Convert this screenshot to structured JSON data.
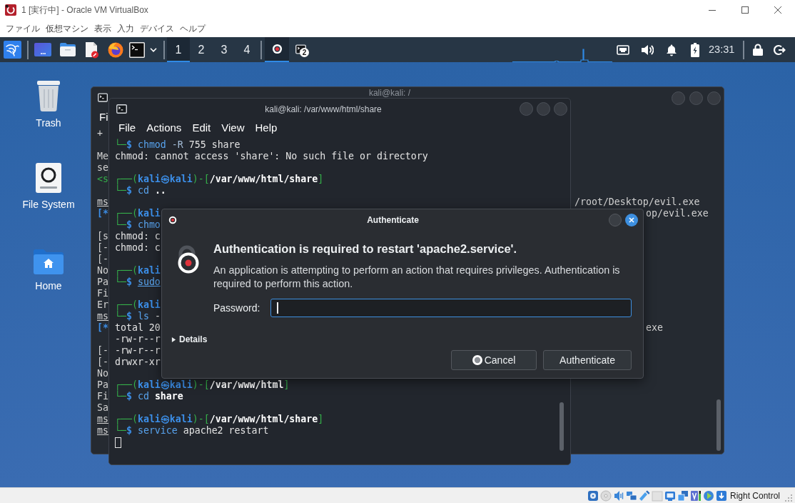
{
  "window": {
    "title": "1 [実行中] - Oracle VM VirtualBox"
  },
  "menu": [
    "ファイル",
    "仮想マシン",
    "表示",
    "入力",
    "デバイス",
    "ヘルプ"
  ],
  "panel": {
    "workspaces": [
      {
        "label": "1",
        "selected": true
      },
      {
        "label": "2",
        "selected": false
      },
      {
        "label": "3",
        "selected": false
      },
      {
        "label": "4",
        "selected": false
      }
    ],
    "tasks": [
      {
        "kind": "record",
        "selected": true
      },
      {
        "kind": "terminal",
        "selected": false,
        "badge": "2"
      }
    ],
    "clock": "23:31"
  },
  "desktop_icons": [
    {
      "kind": "trash",
      "label": "Trash"
    },
    {
      "kind": "drive",
      "label": "File System"
    },
    {
      "kind": "home",
      "label": "Home"
    }
  ],
  "back_terminal": {
    "title": "kali@kali: /",
    "menu": [
      "Fi"
    ],
    "lines": [
      {
        "kind": "text",
        "left": {
          "kind": "text",
          "text": "+"
        }
      },
      {
        "kind": "blank"
      },
      {
        "kind": "text",
        "left": {
          "kind": "text",
          "text": "Me"
        }
      },
      {
        "kind": "text",
        "left": {
          "kind": "text",
          "text": "se"
        }
      },
      {
        "kind": "text",
        "left": {
          "kind": "hint",
          "text": "<s"
        }
      },
      {
        "kind": "blank"
      },
      {
        "kind": "text",
        "left": {
          "kind": "prompt",
          "text": "ms"
        },
        "right": "/root/Desktop/evil.exe"
      },
      {
        "kind": "text",
        "left": {
          "kind": "info",
          "text": "[*"
        },
        "right": "op/evil.exe"
      },
      {
        "kind": "blank"
      },
      {
        "kind": "text",
        "left": {
          "kind": "text",
          "text": "[s"
        }
      },
      {
        "kind": "text",
        "left": {
          "kind": "text",
          "text": "[-"
        }
      },
      {
        "kind": "text",
        "left": {
          "kind": "text",
          "text": "[-"
        }
      },
      {
        "kind": "text",
        "left": {
          "kind": "text",
          "text": "No"
        }
      },
      {
        "kind": "text",
        "left": {
          "kind": "text",
          "text": "Pa"
        }
      },
      {
        "kind": "text",
        "left": {
          "kind": "text",
          "text": "Fi"
        }
      },
      {
        "kind": "text",
        "left": {
          "kind": "text",
          "text": "Er"
        }
      },
      {
        "kind": "text",
        "left": {
          "kind": "prompt",
          "text": "ms"
        }
      },
      {
        "kind": "text",
        "left": {
          "kind": "info",
          "text": "[*"
        },
        "right": "exe"
      },
      {
        "kind": "blank"
      },
      {
        "kind": "text",
        "left": {
          "kind": "text",
          "text": "[-"
        }
      },
      {
        "kind": "text",
        "left": {
          "kind": "text",
          "text": "[-"
        }
      },
      {
        "kind": "text",
        "left": {
          "kind": "text",
          "text": "No"
        }
      },
      {
        "kind": "text",
        "left": {
          "kind": "text",
          "text": "Pa"
        }
      },
      {
        "kind": "text",
        "left": {
          "kind": "text",
          "text": "Fi"
        }
      },
      {
        "kind": "text",
        "left": {
          "kind": "text",
          "text": "Sa"
        }
      },
      {
        "kind": "text",
        "left": {
          "kind": "prompt",
          "text": "ms"
        }
      },
      {
        "kind": "text",
        "left": {
          "kind": "prompt",
          "text": "ms"
        }
      }
    ]
  },
  "front_terminal": {
    "title": "kali@kali: /var/www/html/share",
    "menu": [
      "File",
      "Actions",
      "Edit",
      "View",
      "Help"
    ],
    "lines": [
      {
        "kind": "text",
        "segments": [
          {
            "kind": "frame",
            "text": "└─"
          },
          {
            "kind": "dollar",
            "text": "$ "
          },
          {
            "kind": "cmd",
            "text": "chmod"
          },
          {
            "kind": "flag",
            "text": " -R"
          },
          {
            "kind": "arg",
            "text": " 755 share"
          }
        ]
      },
      {
        "kind": "text",
        "segments": [
          {
            "kind": "out",
            "text": "chmod: cannot access 'share': No such file or directory"
          }
        ]
      },
      {
        "kind": "blank"
      },
      {
        "kind": "text",
        "segments": [
          {
            "kind": "frame",
            "text": "┌──("
          },
          {
            "kind": "host",
            "text": "kali㉿kali"
          },
          {
            "kind": "frame",
            "text": ")-["
          },
          {
            "kind": "path",
            "text": "/var/www/html/share"
          },
          {
            "kind": "frame",
            "text": "]"
          }
        ]
      },
      {
        "kind": "text",
        "segments": [
          {
            "kind": "frame",
            "text": "└─"
          },
          {
            "kind": "dollar",
            "text": "$ "
          },
          {
            "kind": "cmd",
            "text": "cd"
          },
          {
            "kind": "dir",
            "text": " .."
          }
        ]
      },
      {
        "kind": "blank"
      },
      {
        "kind": "text",
        "segments": [
          {
            "kind": "frame",
            "text": "┌──("
          },
          {
            "kind": "host",
            "text": "kali"
          }
        ]
      },
      {
        "kind": "text",
        "segments": [
          {
            "kind": "frame",
            "text": "└─"
          },
          {
            "kind": "dollar",
            "text": "$ "
          },
          {
            "kind": "cmd",
            "text": "chmo"
          }
        ]
      },
      {
        "kind": "text",
        "segments": [
          {
            "kind": "out",
            "text": "chmod: c"
          }
        ]
      },
      {
        "kind": "text",
        "segments": [
          {
            "kind": "out",
            "text": "chmod: c"
          }
        ]
      },
      {
        "kind": "blank"
      },
      {
        "kind": "text",
        "segments": [
          {
            "kind": "frame",
            "text": "┌──("
          },
          {
            "kind": "host",
            "text": "kali"
          }
        ]
      },
      {
        "kind": "text",
        "segments": [
          {
            "kind": "frame",
            "text": "└─"
          },
          {
            "kind": "dollar",
            "text": "$ "
          },
          {
            "kind": "cmd",
            "text": "sudo",
            "underlined": true
          }
        ]
      },
      {
        "kind": "blank"
      },
      {
        "kind": "text",
        "segments": [
          {
            "kind": "frame",
            "text": "┌──("
          },
          {
            "kind": "host",
            "text": "kali"
          }
        ]
      },
      {
        "kind": "text",
        "segments": [
          {
            "kind": "frame",
            "text": "└─"
          },
          {
            "kind": "dollar",
            "text": "$ "
          },
          {
            "kind": "cmd",
            "text": "ls"
          },
          {
            "kind": "arg",
            "text": " -"
          }
        ]
      },
      {
        "kind": "text",
        "segments": [
          {
            "kind": "out",
            "text": "total 20"
          }
        ]
      },
      {
        "kind": "text",
        "segments": [
          {
            "kind": "out",
            "text": "-rw-r--r"
          }
        ]
      },
      {
        "kind": "text",
        "segments": [
          {
            "kind": "out",
            "text": "-rw-r--r"
          }
        ]
      },
      {
        "kind": "text",
        "segments": [
          {
            "kind": "out",
            "text": "drwxr-xr"
          }
        ]
      },
      {
        "kind": "blank"
      },
      {
        "kind": "text",
        "segments": [
          {
            "kind": "frame",
            "text": "┌──("
          },
          {
            "kind": "host",
            "text": "kali㉿kali"
          },
          {
            "kind": "frame",
            "text": ")-["
          },
          {
            "kind": "path",
            "text": "/var/www/html"
          },
          {
            "kind": "frame",
            "text": "]"
          }
        ]
      },
      {
        "kind": "text",
        "segments": [
          {
            "kind": "frame",
            "text": "└─"
          },
          {
            "kind": "dollar",
            "text": "$ "
          },
          {
            "kind": "cmd",
            "text": "cd"
          },
          {
            "kind": "dir",
            "text": " share"
          }
        ]
      },
      {
        "kind": "blank"
      },
      {
        "kind": "text",
        "segments": [
          {
            "kind": "frame",
            "text": "┌──("
          },
          {
            "kind": "host",
            "text": "kali㉿kali"
          },
          {
            "kind": "frame",
            "text": ")-["
          },
          {
            "kind": "path",
            "text": "/var/www/html/share"
          },
          {
            "kind": "frame",
            "text": "]"
          }
        ]
      },
      {
        "kind": "text",
        "segments": [
          {
            "kind": "frame",
            "text": "└─"
          },
          {
            "kind": "dollar",
            "text": "$ "
          },
          {
            "kind": "cmd",
            "text": "service"
          },
          {
            "kind": "arg",
            "text": " apache2 restart"
          }
        ]
      }
    ]
  },
  "dialog": {
    "title": "Authenticate",
    "heading": "Authentication is required to restart 'apache2.service'.",
    "message": "An application is attempting to perform an action that requires privileges. Authentication is required to perform this action.",
    "password": {
      "label": "Password:",
      "focused": true
    },
    "details": {
      "label": "Details",
      "expanded": false
    },
    "buttons": [
      {
        "kind": "cancel",
        "label": "Cancel"
      },
      {
        "kind": "confirm",
        "label": "Authenticate"
      }
    ]
  },
  "status_bar": {
    "host_key": "Right Control"
  }
}
